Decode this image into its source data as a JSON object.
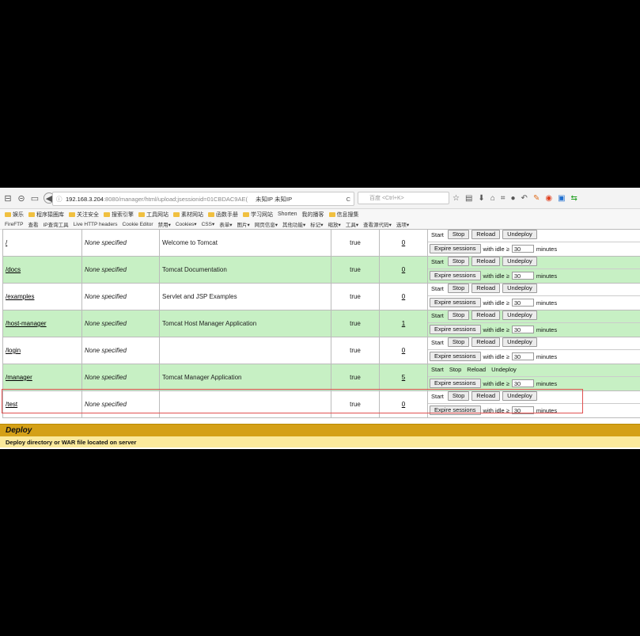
{
  "browser": {
    "url_host": "192.168.3.204",
    "url_path": ":8080/manager/html/upload;jsessionid=01CBDAC9AE(",
    "url_extra": "未知IP   未知IP",
    "search_placeholder": "百度 <Ctrl+K>",
    "bookmarks": [
      "娱乐",
      "程序猿圈库",
      "关注安全",
      "搜索引擎",
      "工具网站",
      "素材网站",
      "函数手册",
      "学习网站",
      "Shorten",
      "我的播客",
      "信息搜集"
    ],
    "addons": [
      "FireFTP",
      "查看",
      "IP查询工具",
      "Live HTTP headers",
      "Cookie Editor",
      "禁用▾",
      "Cookies▾",
      "CSS▾",
      "表单▾",
      "图片▾",
      "网页信息▾",
      "其他功能▾",
      "标记▾",
      "缩放▾",
      "工具▾",
      "查看源代码▾",
      "选项▾"
    ]
  },
  "labels": {
    "start": "Start",
    "stop": "Stop",
    "reload": "Reload",
    "undeploy": "Undeploy",
    "expire": "Expire sessions",
    "with_idle": "with idle ≥",
    "minutes": "minutes",
    "idle_value": "30"
  },
  "apps": [
    {
      "path": "/",
      "version": "None specified",
      "display_name": "Welcome to Tomcat",
      "running": "true",
      "sessions": "0"
    },
    {
      "path": "/docs",
      "version": "None specified",
      "display_name": "Tomcat Documentation",
      "running": "true",
      "sessions": "0"
    },
    {
      "path": "/examples",
      "version": "None specified",
      "display_name": "Servlet and JSP Examples",
      "running": "true",
      "sessions": "0"
    },
    {
      "path": "/host-manager",
      "version": "None specified",
      "display_name": "Tomcat Host Manager Application",
      "running": "true",
      "sessions": "1"
    },
    {
      "path": "/login",
      "version": "None specified",
      "display_name": "",
      "running": "true",
      "sessions": "0"
    },
    {
      "path": "/manager",
      "version": "None specified",
      "display_name": "Tomcat Manager Application",
      "running": "true",
      "sessions": "5"
    },
    {
      "path": "/test",
      "version": "None specified",
      "display_name": "",
      "running": "true",
      "sessions": "0"
    }
  ],
  "deploy": {
    "title": "Deploy",
    "subtitle": "Deploy directory or WAR file located on server"
  },
  "colors": {
    "row_green": "#c7f0c4",
    "deploy_bar": "#d4a017",
    "highlight": "#e05050"
  }
}
